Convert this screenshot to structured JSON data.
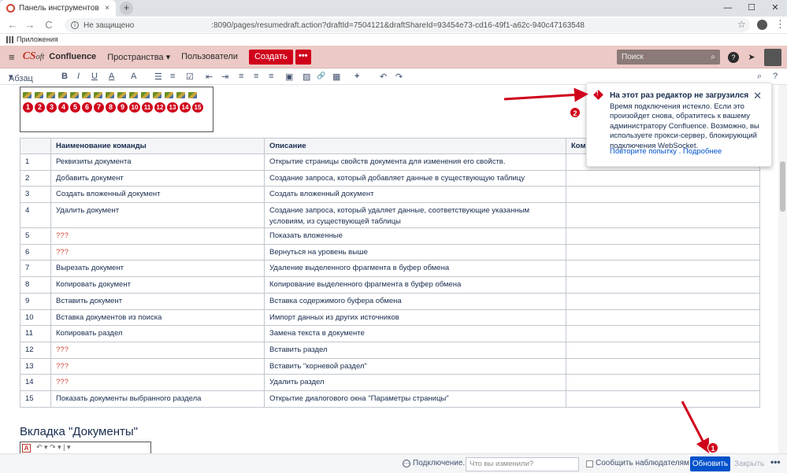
{
  "browser": {
    "tab_title": "Панель инструментов и вклад",
    "tab_close": "×",
    "new_tab": "+",
    "win_min": "—",
    "win_max": "☐",
    "win_close": "✕",
    "back": "←",
    "forward": "→",
    "reload": "C",
    "not_secure": "Не защищено",
    "url_path": ":8090/pages/resumedraft.action?draftId=7504121&draftShareId=93454e73-cd16-49f1-a62c-940c47163548",
    "bookmarks_label": "Приложения",
    "star": "☆",
    "menu": "⋮"
  },
  "header": {
    "menu": "≡",
    "logo_main": "CS",
    "logo_rest": "oft",
    "app_name": "Confluence",
    "spaces": "Пространства ▾",
    "users": "Пользователи",
    "create": "Создать",
    "more": "•••",
    "search_placeholder": "Поиск",
    "search_icon": "⌕",
    "help": "?",
    "notif": "➤"
  },
  "editor_toolbar": {
    "style": "Абзац",
    "bold": "B",
    "italic": "I",
    "underline": "U",
    "color": "A",
    "more_fmt": "A",
    "bullets": "☰",
    "numbered": "≡",
    "task": "☑",
    "outdent": "⇤",
    "indent": "⇥",
    "align_left": "≡",
    "align_center": "≡",
    "align_right": "≡",
    "layout": "▣",
    "image": "▨",
    "link": "🔗",
    "table": "▦",
    "insert": "+",
    "undo": "↶",
    "redo": "↷",
    "find": "⌕",
    "help": "?"
  },
  "toolbar_image": {
    "badges": [
      "1",
      "2",
      "3",
      "4",
      "5",
      "6",
      "7",
      "8",
      "9",
      "10",
      "11",
      "12",
      "13",
      "14",
      "15"
    ]
  },
  "table": {
    "headers": [
      "",
      "Наименование команды",
      "Описание",
      "Ком"
    ],
    "rows": [
      {
        "num": "1",
        "name": "Реквизиты документа",
        "desc": "Открытие страницы свойств документа для изменения его свойств.",
        "red": false
      },
      {
        "num": "2",
        "name": "Добавить документ",
        "desc": "Создание запроса, который добавляет данные в существующую таблицу",
        "red": false
      },
      {
        "num": "3",
        "name": "Создать вложенный документ",
        "desc": "Создать вложенный документ",
        "red": false
      },
      {
        "num": "4",
        "name": "Удалить документ",
        "desc": "Создание запроса, который удаляет данные, соответствующие указанным условиям, из существующей таблицы",
        "red": false,
        "tall": true
      },
      {
        "num": "5",
        "name": "???",
        "desc": "Показать вложенные",
        "red": true
      },
      {
        "num": "6",
        "name": "???",
        "desc": "Вернуться на уровень выше",
        "red": true
      },
      {
        "num": "7",
        "name": "Вырезать документ",
        "desc": "Удаление выделенного фрагмента в буфер обмена",
        "red": false
      },
      {
        "num": "8",
        "name": "Копировать документ",
        "desc": "Копирование выделенного фрагмента в буфер обмена",
        "red": false
      },
      {
        "num": "9",
        "name": "Вставить документ",
        "desc": "Вставка содержимого буфера обмена",
        "red": false
      },
      {
        "num": "10",
        "name": "Вставка документов из поиска",
        "desc": "Импорт данных из других источников",
        "red": false
      },
      {
        "num": "11",
        "name": "Копировать раздел",
        "desc": "Замена текста в документе",
        "red": false
      },
      {
        "num": "12",
        "name": "???",
        "desc": "Вставить раздел",
        "red": true
      },
      {
        "num": "13",
        "name": "???",
        "desc": "Вставить \"корневой раздел\"",
        "red": true
      },
      {
        "num": "14",
        "name": "???",
        "desc": "Удалить раздел",
        "red": true
      },
      {
        "num": "15",
        "name": "Показать документы выбранного раздела",
        "desc": "Открытие диалогового окна \"Параметры страницы\"",
        "red": false
      }
    ]
  },
  "section_heading": "Вкладка \"Документы\"",
  "doc_toolbar_image": {
    "icon": "A",
    "rest": "↶ ▾  ↷ ▾  | ▾"
  },
  "error_popup": {
    "icon": "!",
    "title": "На этот раз редактор не загрузился",
    "close": "✕",
    "body": "Время подключения истекло. Если это произойдет снова, обратитесь к вашему администратору Confluence. Возможно, вы используете прокси-сервер, блокирующий подключения WebSocket.",
    "retry": "Повторите попытку",
    "sep": " . ",
    "details": "Подробнее"
  },
  "annotations": {
    "badge1": "1",
    "badge2": "2",
    "color": "#d0021b"
  },
  "footer": {
    "status_icon": "⋯",
    "status": "Подключение...",
    "message_placeholder": "Что вы изменили?",
    "notify_label": "Сообщить наблюдателям",
    "update": "Обновить",
    "close": "Закрыть",
    "more": "•••"
  }
}
